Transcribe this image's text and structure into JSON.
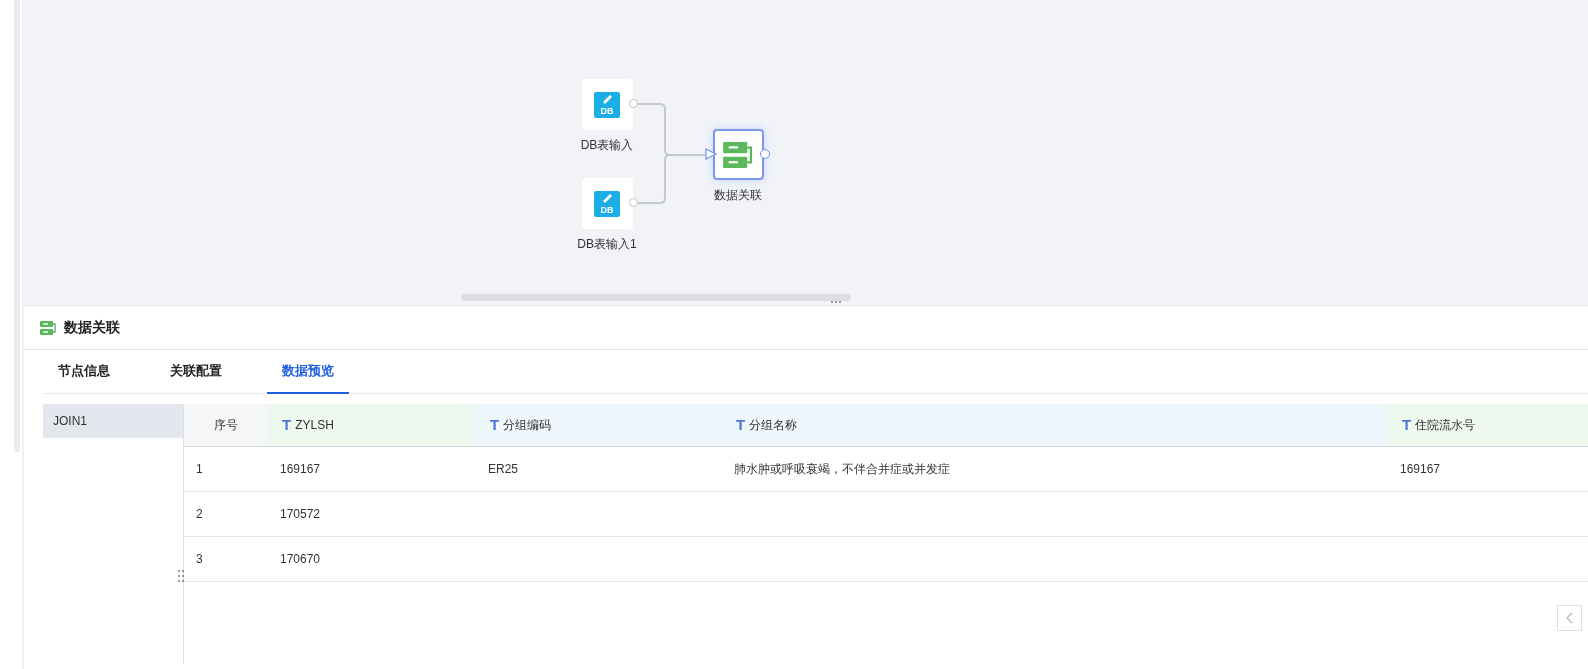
{
  "canvas": {
    "nodes": [
      {
        "kind": "db",
        "label": "DB表输入",
        "badge": "DB",
        "selected": false
      },
      {
        "kind": "db",
        "label": "DB表输入1",
        "badge": "DB",
        "selected": false
      },
      {
        "kind": "join",
        "label": "数据关联",
        "selected": true
      }
    ]
  },
  "panel": {
    "title": "数据关联",
    "tabs": [
      {
        "label": "节点信息",
        "selected": false
      },
      {
        "label": "关联配置",
        "selected": false
      },
      {
        "label": "数据预览",
        "selected": true
      }
    ],
    "sidebar": {
      "items": [
        {
          "label": "JOIN1",
          "selected": true
        }
      ]
    },
    "table": {
      "columns": [
        {
          "label": "序号"
        },
        {
          "label": "ZYLSH",
          "icon": "T",
          "color": "#eef8ee"
        },
        {
          "label": "分组编码",
          "icon": "T",
          "color": "#eff7fd"
        },
        {
          "label": "分组名称",
          "icon": "T",
          "color": "#eff7fd"
        },
        {
          "label": "住院流水号",
          "icon": "T",
          "color": "#eef8ee"
        }
      ],
      "rows": [
        {
          "cells": [
            "1",
            "169167",
            "ER25",
            "肺水肿或呼吸衰竭，不伴合并症或并发症",
            "169167"
          ]
        },
        {
          "cells": [
            "2",
            "170572"
          ]
        },
        {
          "cells": [
            "3",
            "170670"
          ]
        }
      ]
    }
  }
}
